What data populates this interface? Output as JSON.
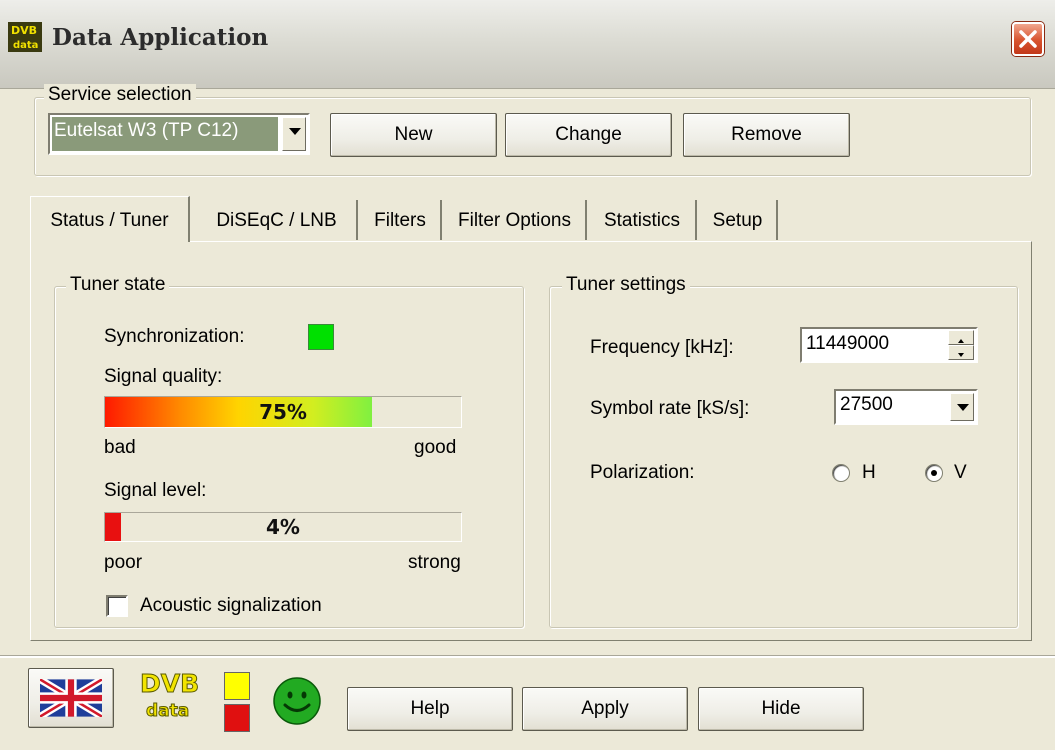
{
  "window": {
    "title": "Data Application"
  },
  "service_selection": {
    "label": "Service selection",
    "selected": "Eutelsat W3 (TP C12)",
    "buttons": {
      "new": "New",
      "change": "Change",
      "remove": "Remove"
    }
  },
  "tabs": [
    {
      "label": "Status / Tuner",
      "active": true
    },
    {
      "label": "DiSEqC / LNB"
    },
    {
      "label": "Filters"
    },
    {
      "label": "Filter Options"
    },
    {
      "label": "Statistics"
    },
    {
      "label": "Setup"
    }
  ],
  "tuner_state": {
    "label": "Tuner state",
    "synchronization_label": "Synchronization:",
    "synchronization_color": "#00e000",
    "signal_quality_label": "Signal quality:",
    "signal_quality_value": 0.75,
    "signal_quality_text": "75%",
    "quality_low": "bad",
    "quality_high": "good",
    "signal_level_label": "Signal level:",
    "signal_level_value": 0.04,
    "signal_level_text": "4%",
    "level_low": "poor",
    "level_high": "strong",
    "acoustic_label": "Acoustic signalization",
    "acoustic_checked": false
  },
  "tuner_settings": {
    "label": "Tuner settings",
    "frequency_label": "Frequency [kHz]:",
    "frequency_value": "11449000",
    "symbol_rate_label": "Symbol rate [kS/s]:",
    "symbol_rate_value": "27500",
    "polarization_label": "Polarization:",
    "polarization_h": "H",
    "polarization_v": "V",
    "polarization_selected": "V"
  },
  "bottom": {
    "logo_top": "DVB",
    "logo_bottom": "data",
    "led_top_color": "#ffff00",
    "led_bottom_color": "#e01010",
    "help": "Help",
    "apply": "Apply",
    "hide": "Hide"
  },
  "colors": {
    "window_bg": "#ece9d8",
    "close_button": "#d8532e",
    "smiley": "#22aa22"
  }
}
